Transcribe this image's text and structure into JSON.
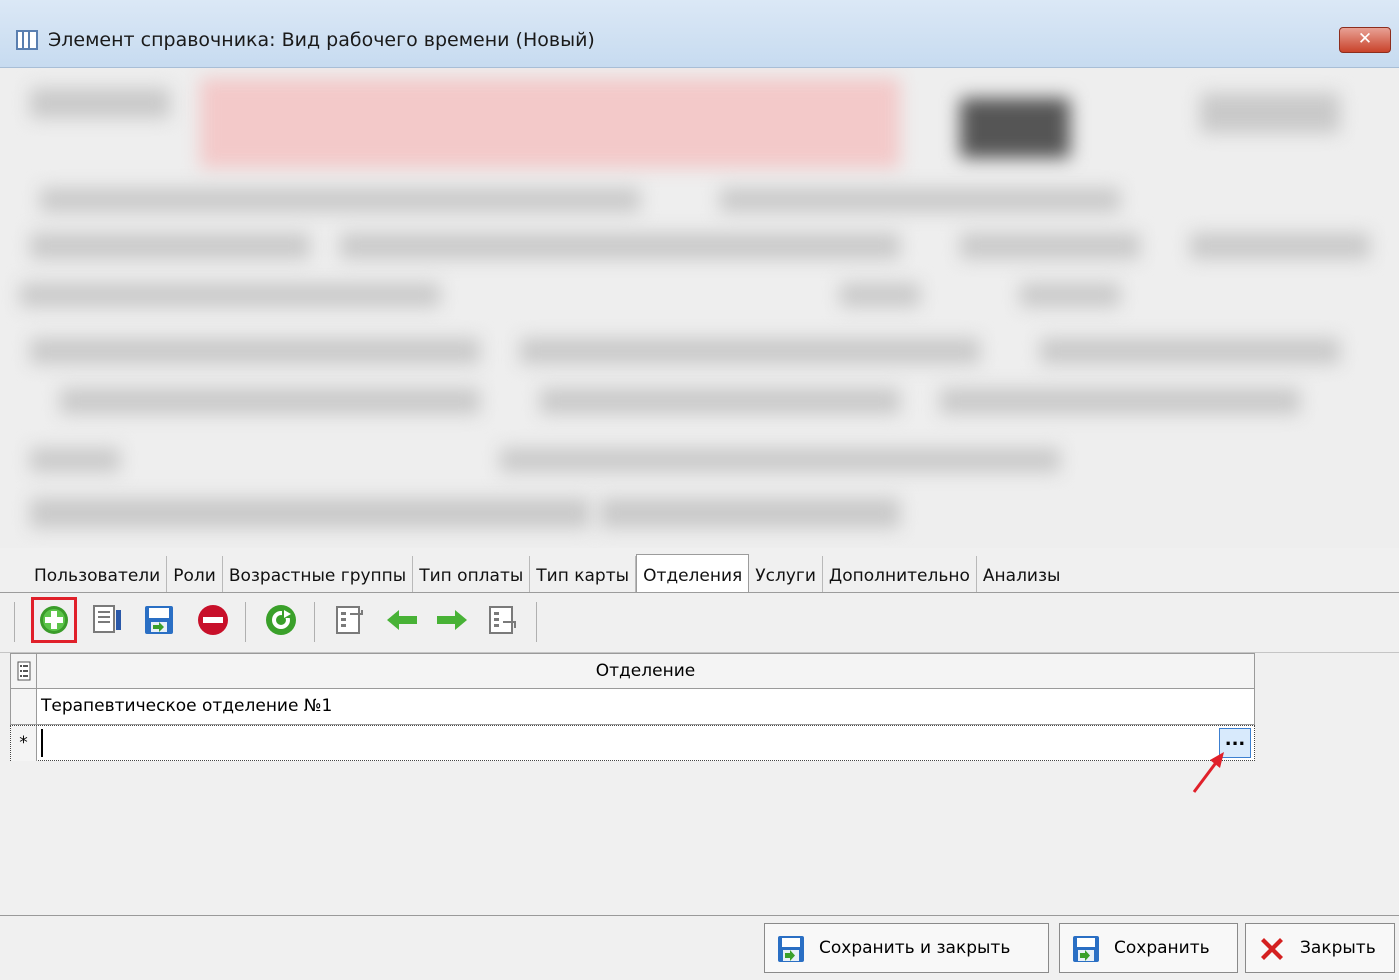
{
  "window": {
    "title": "Элемент справочника: Вид рабочего времени (Новый)",
    "close_label": "✕"
  },
  "tabs": [
    {
      "label": "Пользователи",
      "active": false
    },
    {
      "label": "Роли",
      "active": false
    },
    {
      "label": "Возрастные группы",
      "active": false
    },
    {
      "label": "Тип оплаты",
      "active": false
    },
    {
      "label": "Тип карты",
      "active": false
    },
    {
      "label": "Отделения",
      "active": true
    },
    {
      "label": "Услуги",
      "active": false
    },
    {
      "label": "Дополнительно",
      "active": false
    },
    {
      "label": "Анализы",
      "active": false
    }
  ],
  "toolbar": {
    "buttons": [
      "add-icon",
      "edit-icon",
      "save-icon",
      "delete-icon",
      "refresh-icon",
      "move-in-icon",
      "arrow-left-icon",
      "arrow-right-icon",
      "move-out-icon"
    ],
    "highlighted": "add-icon"
  },
  "grid": {
    "column_header": "Отделение",
    "rows": [
      {
        "value": "Терапевтическое отделение №1"
      }
    ],
    "new_row_marker": "*",
    "ellipsis_label": "..."
  },
  "buttons": {
    "save_close": "Сохранить и закрыть",
    "save": "Сохранить",
    "close": "Закрыть"
  },
  "colors": {
    "highlight": "#e0202a",
    "accent": "#3c7fd0"
  }
}
